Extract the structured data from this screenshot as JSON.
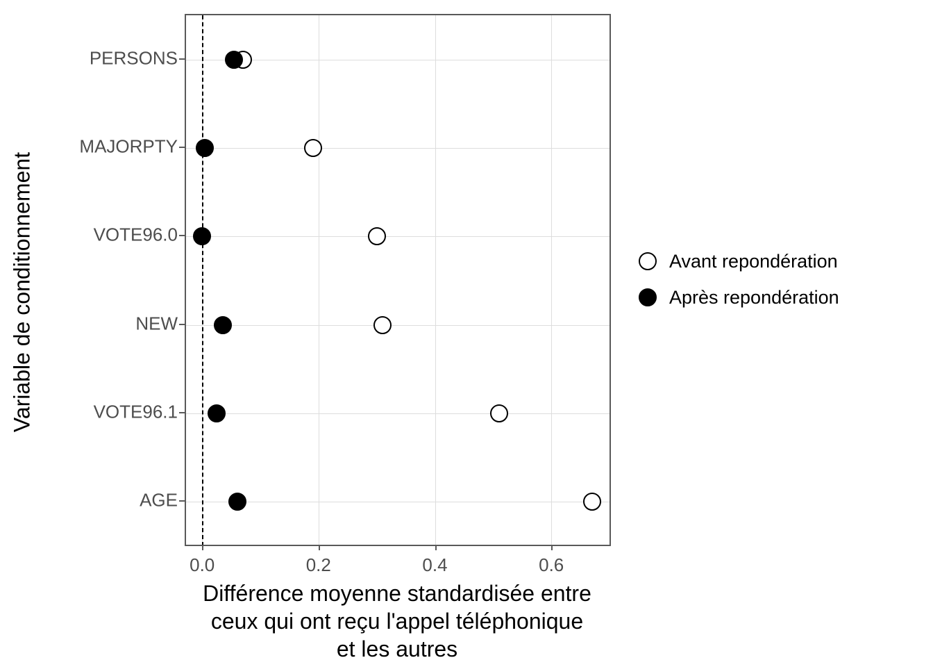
{
  "chart_data": {
    "type": "scatter",
    "xlabel": "Différence moyenne standardisée entre\nceux qui ont reçu l'appel téléphonique\net les autres",
    "ylabel": "Variable de conditionnement",
    "xlim": [
      -0.03,
      0.7
    ],
    "x_ticks": [
      0.0,
      0.2,
      0.4,
      0.6
    ],
    "x_tick_labels": [
      "0.0",
      "0.2",
      "0.4",
      "0.6"
    ],
    "ref_vline": 0.0,
    "categories": [
      "PERSONS",
      "MAJORPTY",
      "VOTE96.0",
      "NEW",
      "VOTE96.1",
      "AGE"
    ],
    "series": [
      {
        "name": "Avant repondération",
        "marker": "open",
        "values": [
          0.07,
          0.19,
          0.3,
          0.31,
          0.51,
          0.67
        ]
      },
      {
        "name": "Après repondération",
        "marker": "filled",
        "values": [
          0.055,
          0.005,
          0.0,
          0.035,
          0.025,
          0.06
        ]
      }
    ],
    "legend_position": "right",
    "grid": true
  },
  "x_tick_labels": {
    "t0": "0.0",
    "t1": "0.2",
    "t2": "0.4",
    "t3": "0.6"
  },
  "y_tick_labels": {
    "c0": "PERSONS",
    "c1": "MAJORPTY",
    "c2": "VOTE96.0",
    "c3": "NEW",
    "c4": "VOTE96.1",
    "c5": "AGE"
  },
  "axis_titles": {
    "x_line1": "Différence moyenne standardisée entre",
    "x_line2": "ceux qui ont reçu l'appel téléphonique",
    "x_line3": "et les autres",
    "y": "Variable de conditionnement"
  },
  "legend": {
    "item0": "Avant repondération",
    "item1": "Après repondération"
  }
}
